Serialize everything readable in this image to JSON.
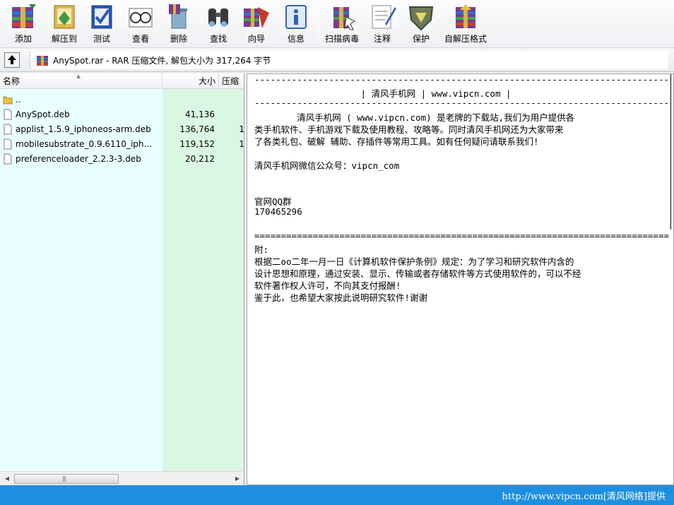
{
  "toolbar": {
    "buttons": [
      {
        "label": "添加",
        "icon": "add-archive-icon"
      },
      {
        "label": "解压到",
        "icon": "extract-to-icon"
      },
      {
        "label": "测试",
        "icon": "test-icon"
      },
      {
        "label": "查看",
        "icon": "view-icon"
      },
      {
        "label": "删除",
        "icon": "delete-icon"
      },
      {
        "label": "查找",
        "icon": "find-icon"
      },
      {
        "label": "向导",
        "icon": "wizard-icon"
      },
      {
        "label": "信息",
        "icon": "info-icon"
      },
      {
        "label": "扫描病毒",
        "icon": "virus-scan-icon"
      },
      {
        "label": "注释",
        "icon": "comment-icon"
      },
      {
        "label": "保护",
        "icon": "protect-icon"
      },
      {
        "label": "自解压格式",
        "icon": "sfx-icon"
      }
    ]
  },
  "address": {
    "text": "AnySpot.rar - RAR 压缩文件, 解包大小为 317,264 字节"
  },
  "filelist": {
    "columns": {
      "name": "名称",
      "size": "大小",
      "compressed": "压缩"
    },
    "rows": [
      {
        "name": "..",
        "size": "",
        "compressed": "",
        "type": "folder"
      },
      {
        "name": "AnySpot.deb",
        "size": "41,136",
        "compressed": "",
        "type": "file"
      },
      {
        "name": "applist_1.5.9_iphoneos-arm.deb",
        "size": "136,764",
        "compressed": "1",
        "type": "file"
      },
      {
        "name": "mobilesubstrate_0.9.6110_iphone...",
        "size": "119,152",
        "compressed": "1",
        "type": "file"
      },
      {
        "name": "preferenceloader_2.2.3-3.deb",
        "size": "20,212",
        "compressed": "",
        "type": "file"
      }
    ]
  },
  "comment": {
    "lines": [
      "------------------------------------------------------------------------------",
      "                    | 清风手机网 | www.vipcn.com |",
      "------------------------------------------------------------------------------",
      "        清风手机网 ( www.vipcn.com) 是老牌的下载站,我们为用户提供各",
      "类手机软件、手机游戏下载及使用教程、攻略等。同时清风手机网还为大家带来",
      "了各类礼包、破解 辅助、存插件等常用工具。如有任何疑问请联系我们!",
      "",
      "清风手机网微信公众号：vipcn_com",
      "",
      "",
      "官网QQ群",
      "170465296",
      "",
      "==============================================================================",
      "附:",
      "根据二oo二年一月一日《计算机软件保护条例》规定：为了学习和研究软件内含的",
      "设计思想和原理，通过安装、显示、传输或者存储软件等方式使用软件的，可以不经",
      "软件著作权人许可，不向其支付报酬!",
      "鉴于此，也希望大家按此说明研究软件!谢谢"
    ]
  },
  "footer": {
    "text": "http://www.vipcn.com[清风网络]提供"
  }
}
